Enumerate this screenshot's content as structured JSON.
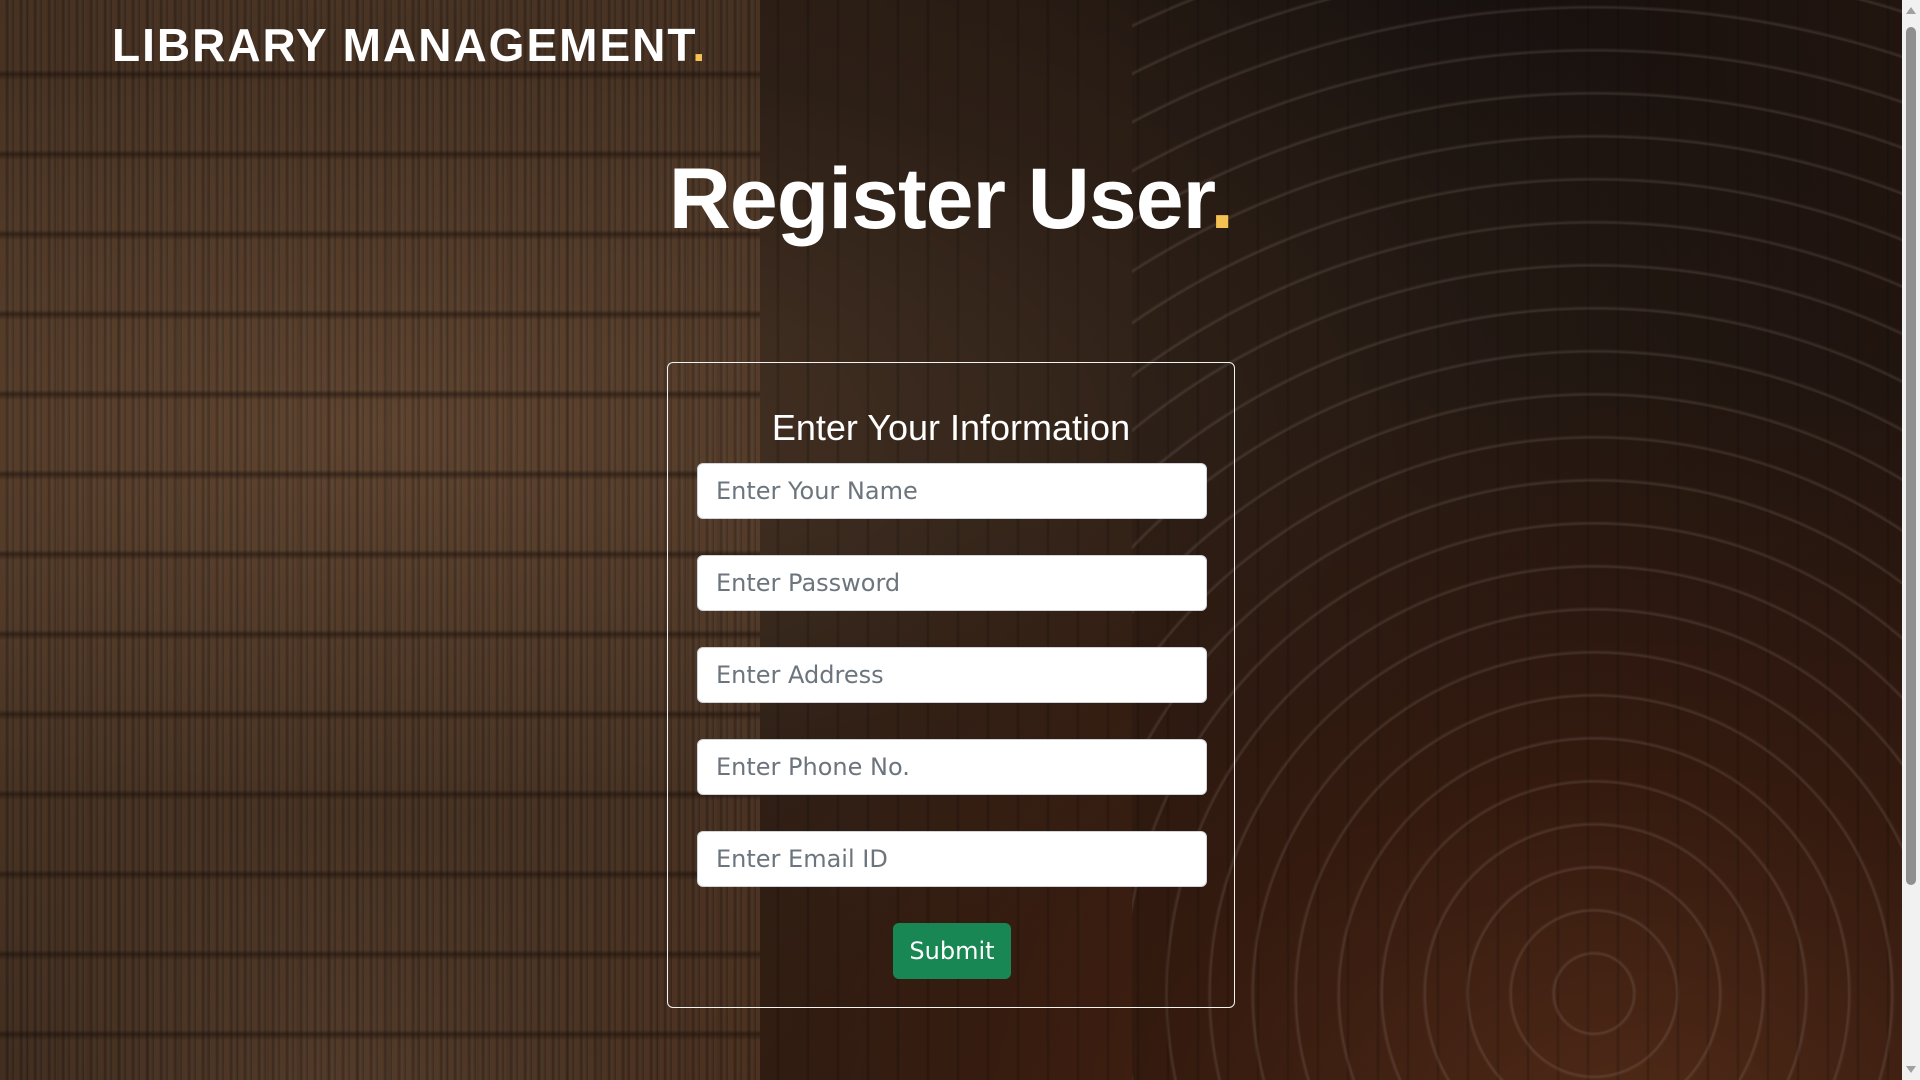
{
  "header": {
    "brand": "LIBRARY MANAGEMENT",
    "brand_dot": "."
  },
  "main": {
    "title": "Register User",
    "title_dot": "."
  },
  "form": {
    "heading": "Enter Your Information",
    "fields": {
      "name_placeholder": "Enter Your Name",
      "password_placeholder": "Enter Password",
      "address_placeholder": "Enter Address",
      "phone_placeholder": "Enter Phone No.",
      "email_placeholder": "Enter Email ID"
    },
    "submit_label": "Submit"
  },
  "colors": {
    "accent_dot": "#f4c152",
    "submit_button": "#198754",
    "text": "#ffffff",
    "background": "#2a1a12"
  },
  "icons": {
    "scroll_up": "triangle-up-icon",
    "scroll_down": "triangle-down-icon"
  }
}
